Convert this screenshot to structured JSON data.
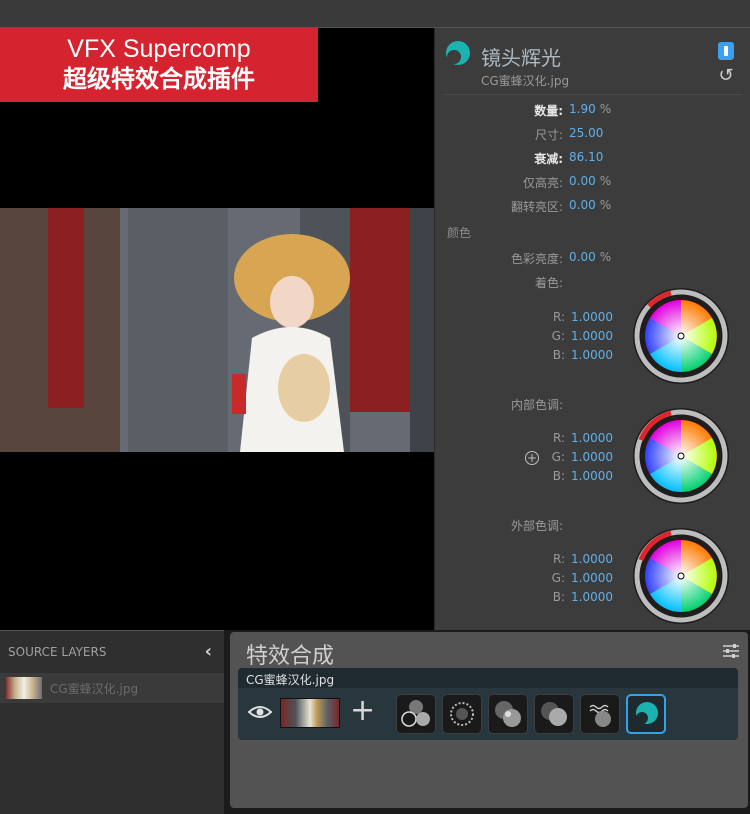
{
  "banner": {
    "line1": "VFX Supercomp",
    "line2": "超级特效合成插件"
  },
  "effect_panel": {
    "effect_name": "镜头辉光",
    "file_name": "CG蜜蜂汉化.jpg",
    "params": [
      {
        "label": "数量:",
        "value": "1.90",
        "unit": "%",
        "bold": true
      },
      {
        "label": "尺寸:",
        "value": "25.00",
        "unit": "",
        "bold": false
      },
      {
        "label": "衰减:",
        "value": "86.10",
        "unit": "",
        "bold": true
      },
      {
        "label": "仅高亮:",
        "value": "0.00",
        "unit": "%",
        "bold": false
      },
      {
        "label": "翻转亮区:",
        "value": "0.00",
        "unit": "%",
        "bold": false
      }
    ],
    "color_section": "颜色",
    "color_brightness": {
      "label": "色彩亮度:",
      "value": "0.00",
      "unit": "%"
    },
    "tint_label": "着色:",
    "tint": {
      "r": "1.0000",
      "g": "1.0000",
      "b": "1.0000"
    },
    "inner_label": "内部色调:",
    "inner": {
      "r": "1.0000",
      "g": "1.0000",
      "b": "1.0000"
    },
    "outer_label": "外部色调:",
    "outer": {
      "r": "1.0000",
      "g": "1.0000",
      "b": "1.0000"
    },
    "rgb_labels": {
      "r": "R:",
      "g": "G:",
      "b": "B:"
    }
  },
  "source_layers": {
    "header": "SOURCE LAYERS",
    "items": [
      {
        "name": "CG蜜蜂汉化.jpg"
      }
    ]
  },
  "composite": {
    "title": "特效合成",
    "layer_name": "CG蜜蜂汉化.jpg",
    "effects": [
      "fx-slot-1-icon",
      "fx-slot-2-icon",
      "fx-slot-3-icon",
      "fx-slot-4-icon",
      "fx-slot-5-icon",
      "lens-glow-icon"
    ]
  },
  "colors": {
    "accent": "#33a3e8",
    "value_blue": "#5fb0ea",
    "banner_red": "#d5232f",
    "teal": "#1bb3b0"
  }
}
